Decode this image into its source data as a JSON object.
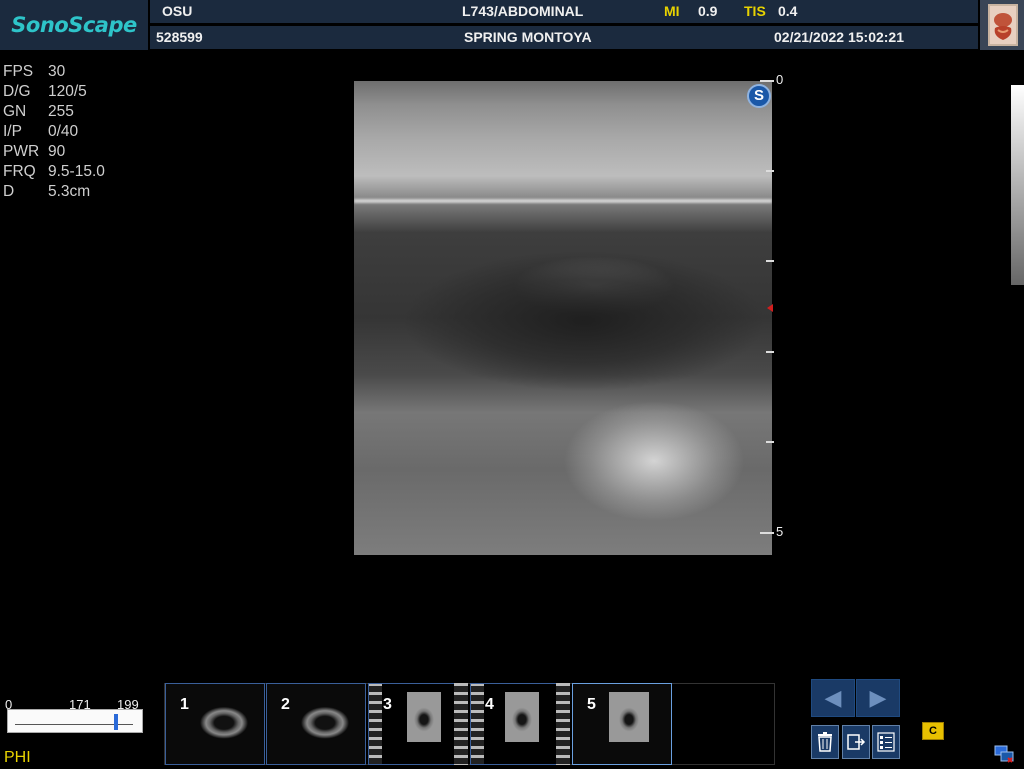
{
  "header": {
    "logo": "SonoScape",
    "institution": "OSU",
    "probe_preset": "L743/ABDOMINAL",
    "mi_label": "MI",
    "mi_value": "0.9",
    "tis_label": "TIS",
    "tis_value": "0.4",
    "patient_id": "528599",
    "patient_name": "SPRING MONTOYA",
    "datetime": "02/21/2022 15:02:21"
  },
  "params": [
    {
      "key": "FPS",
      "value": "30"
    },
    {
      "key": "D/G",
      "value": "120/5"
    },
    {
      "key": "GN",
      "value": "255"
    },
    {
      "key": "I/P",
      "value": "0/40"
    },
    {
      "key": "PWR",
      "value": "90"
    },
    {
      "key": "FRQ",
      "value": "9.5-15.0"
    },
    {
      "key": "D",
      "value": "5.3cm"
    }
  ],
  "image": {
    "badge": "S",
    "depth_top": "0",
    "depth_bottom": "5"
  },
  "cine": {
    "min": "0",
    "current": "171",
    "max": "199",
    "position_fraction": 0.86,
    "mode": "PHI"
  },
  "thumbnails": [
    {
      "number": "1"
    },
    {
      "number": "2"
    },
    {
      "number": "3"
    },
    {
      "number": "4"
    },
    {
      "number": "5"
    }
  ],
  "icons": {
    "prev": "chevron-left-icon",
    "next": "chevron-right-icon",
    "delete": "trash-icon",
    "export": "export-icon",
    "checklist": "checklist-icon",
    "cine": "cine-clip-icon",
    "cine_label": "C",
    "network": "network-icon"
  },
  "colors": {
    "header_bg": "#1b2a3e",
    "logo": "#2ec4c9",
    "highlight": "#e8d300",
    "focus_marker": "#d21e1e",
    "button_bg": "#1a3a66"
  }
}
